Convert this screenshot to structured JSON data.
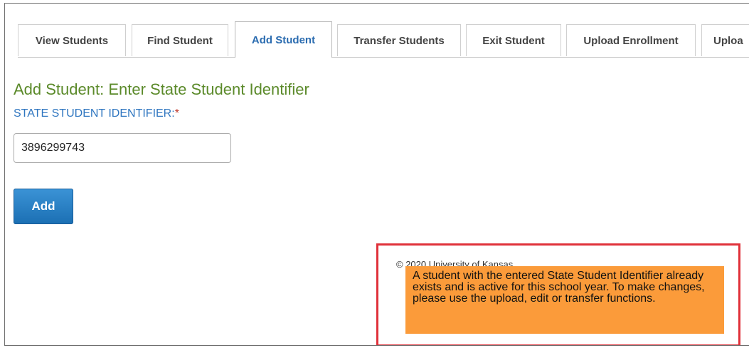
{
  "tabs": [
    {
      "label": "View Students",
      "active": false
    },
    {
      "label": "Find Student",
      "active": false
    },
    {
      "label": "Add Student",
      "active": true
    },
    {
      "label": "Transfer Students",
      "active": false
    },
    {
      "label": "Exit Student",
      "active": false
    },
    {
      "label": "Upload Enrollment",
      "active": false
    },
    {
      "label": "Uploa",
      "active": false
    }
  ],
  "main": {
    "title": "Add Student: Enter State Student Identifier",
    "field_label": "STATE STUDENT IDENTIFIER:",
    "required_marker": "*",
    "ssid_value": "3896299743",
    "add_button_label": "Add"
  },
  "footer": {
    "copyright": "© 2020 University of Kansas"
  },
  "alert": {
    "message": "A student with the entered State Student Identifier already exists and is active for this school year. To make changes, please use the upload, edit or transfer functions.",
    "background": "#fb9b3a",
    "highlight_color": "#e0313a"
  },
  "colors": {
    "title_green": "#5b8a2a",
    "label_blue": "#2f76c0",
    "active_tab_blue": "#2b6cb0",
    "button_blue": "#1b6fb3"
  }
}
